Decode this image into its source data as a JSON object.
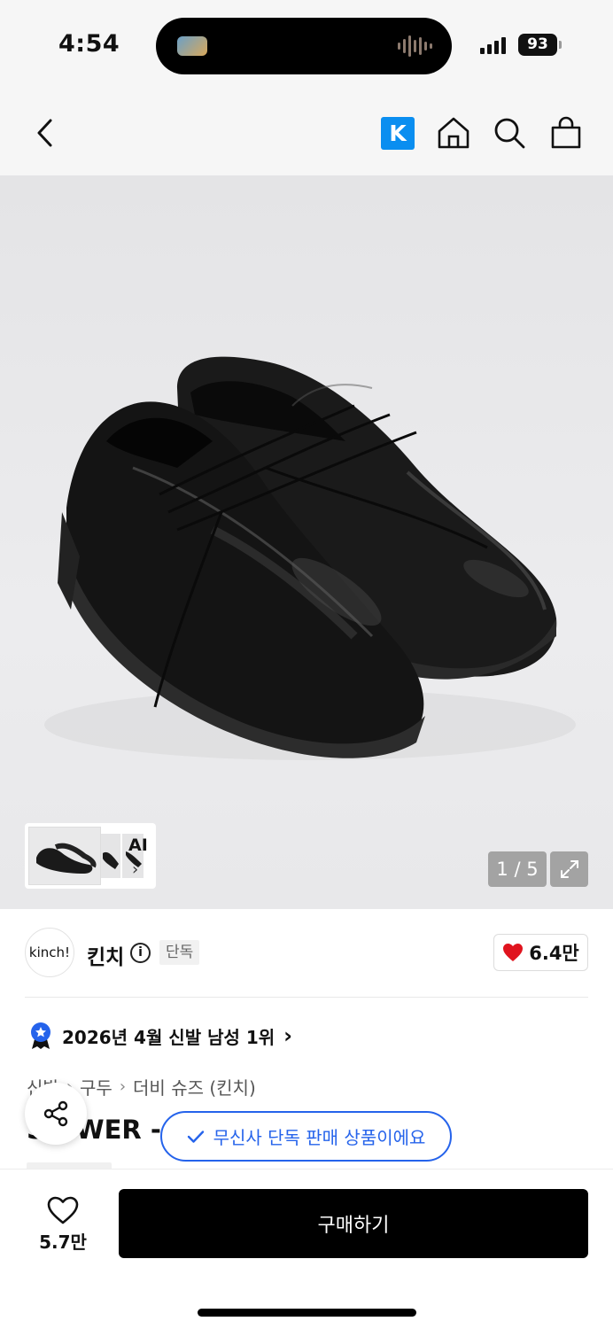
{
  "status_bar": {
    "time": "4:54",
    "battery": "93"
  },
  "header": {
    "back_icon": "chevron-left-icon",
    "k_badge": "K",
    "home_icon": "home-icon",
    "search_icon": "search-icon",
    "cart_icon": "shopping-bag-icon"
  },
  "gallery": {
    "ai_label": "AI",
    "counter": "1 / 5",
    "expand_icon": "expand-icon"
  },
  "brand": {
    "logo_text": "kinch!",
    "name": "킨치",
    "exclusive_tag": "단독",
    "likes": "6.4만"
  },
  "ranking": {
    "text": "2026년 4월 신발 남성 1위"
  },
  "breadcrumb": [
    "신발",
    "구두",
    "더비 슈즈 (킨치)"
  ],
  "product": {
    "title_visible": "S  OWER -"
  },
  "toast": {
    "text": "무신사 단독 판매 상품이에요"
  },
  "bottom_bar": {
    "wish_count": "5.7만",
    "buy_label": "구매하기"
  },
  "colors": {
    "accent_blue": "#2563eb",
    "heart_red": "#e0141e",
    "k_blue": "#0a8ef0"
  }
}
